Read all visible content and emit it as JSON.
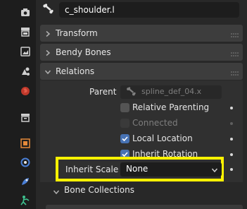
{
  "header": {
    "bone_name": "c_shoulder.l",
    "bone_icon": "bone-icon"
  },
  "sidebar_tabs": [
    {
      "name": "tool-icon"
    },
    {
      "name": "render-icon"
    },
    {
      "name": "output-icon"
    },
    {
      "name": "view-layer-icon"
    },
    {
      "name": "scene-icon"
    },
    {
      "name": "world-icon"
    },
    {
      "name": "collection-icon"
    },
    {
      "name": "object-icon"
    },
    {
      "name": "modifier-icon"
    },
    {
      "name": "particles-icon"
    },
    {
      "name": "bone-tab-icon"
    }
  ],
  "sections": {
    "transform": "Transform",
    "bendy_bones": "Bendy Bones",
    "relations": "Relations",
    "bone_collections": "Bone Collections"
  },
  "relations": {
    "parent_label": "Parent",
    "parent_value": "spline_def_04.x",
    "relative_parenting": {
      "label": "Relative Parenting",
      "checked": false
    },
    "connected": {
      "label": "Connected",
      "checked": false,
      "enabled": false
    },
    "local_location": {
      "label": "Local Location",
      "checked": true
    },
    "inherit_rotation": {
      "label": "Inherit Rotation",
      "checked": true
    },
    "inherit_scale_label": "Inherit Scale",
    "inherit_scale_value": "None"
  },
  "colors": {
    "accent_checkbox": "#4772b3",
    "highlight_box": "#fff200",
    "panel_bg": "#282828",
    "section_header_bg": "#3d3d3d"
  }
}
